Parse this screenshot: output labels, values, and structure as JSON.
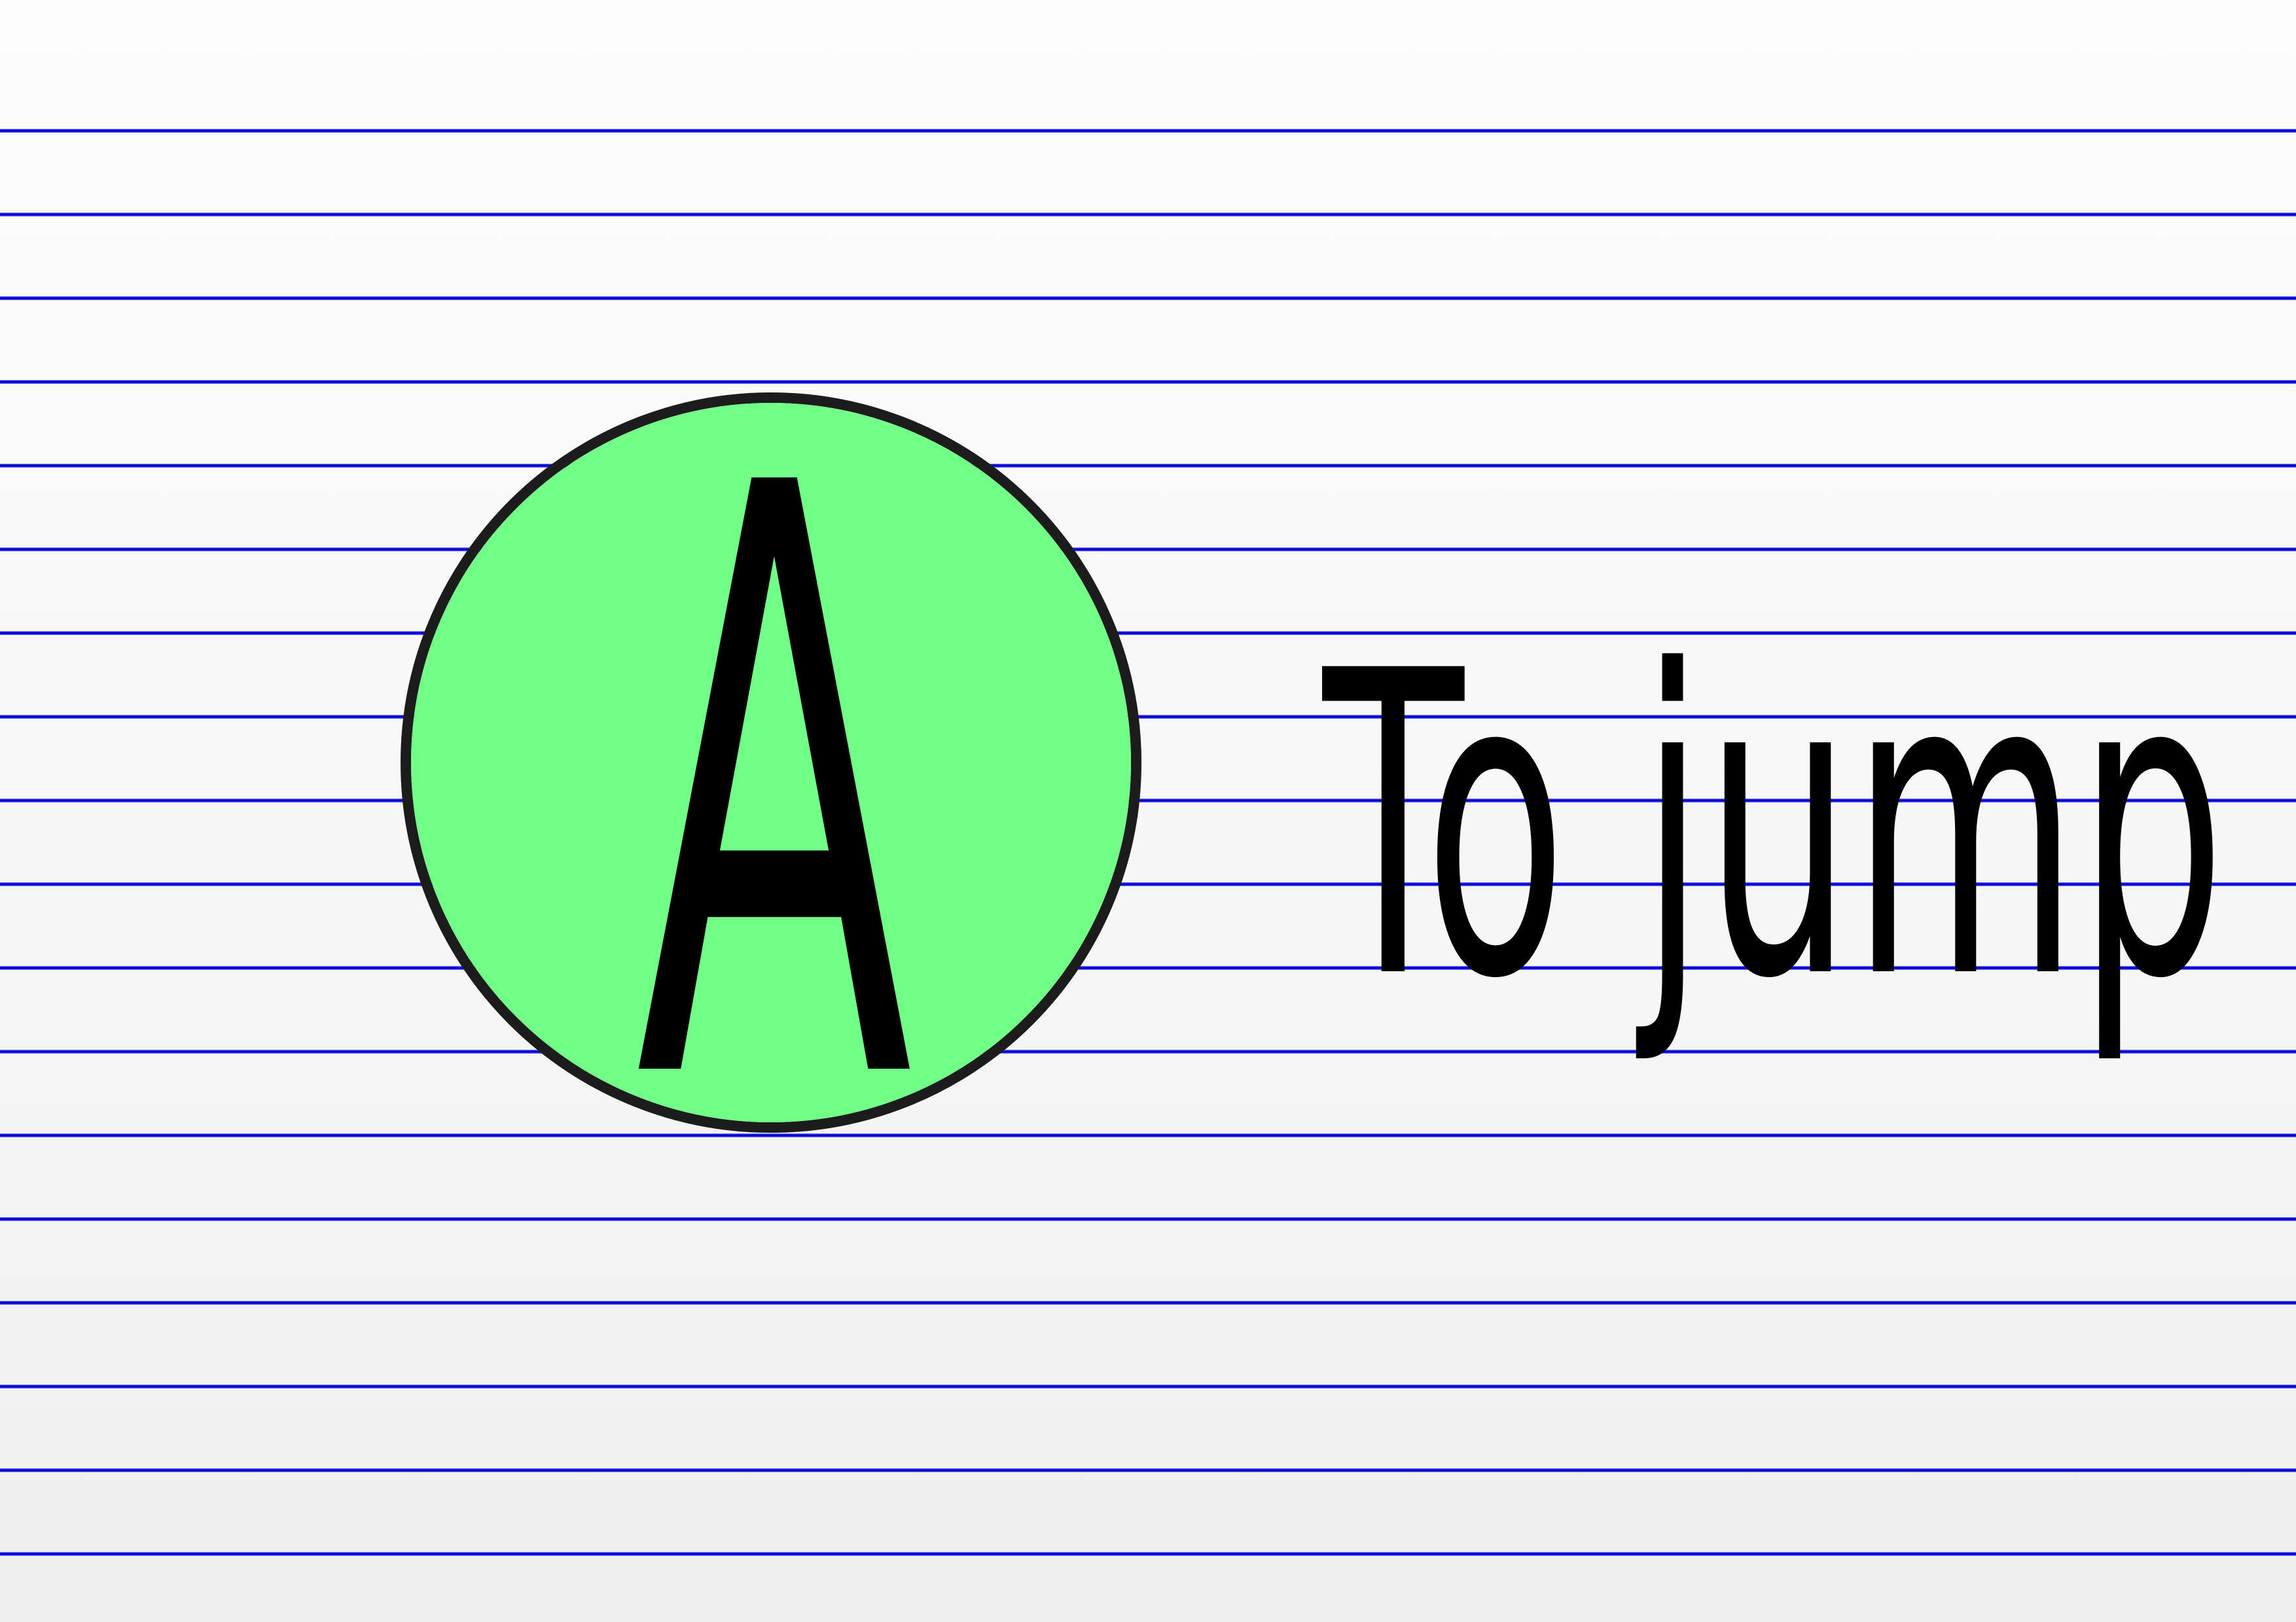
{
  "badge": {
    "letter": "A",
    "fill_color": "#71ff88",
    "border_color": "#1c1c1c"
  },
  "phrase": {
    "text": "To jump",
    "color": "#000000"
  },
  "paper": {
    "background_color": "#f8f8f8",
    "rule_color": "#0000d0"
  }
}
